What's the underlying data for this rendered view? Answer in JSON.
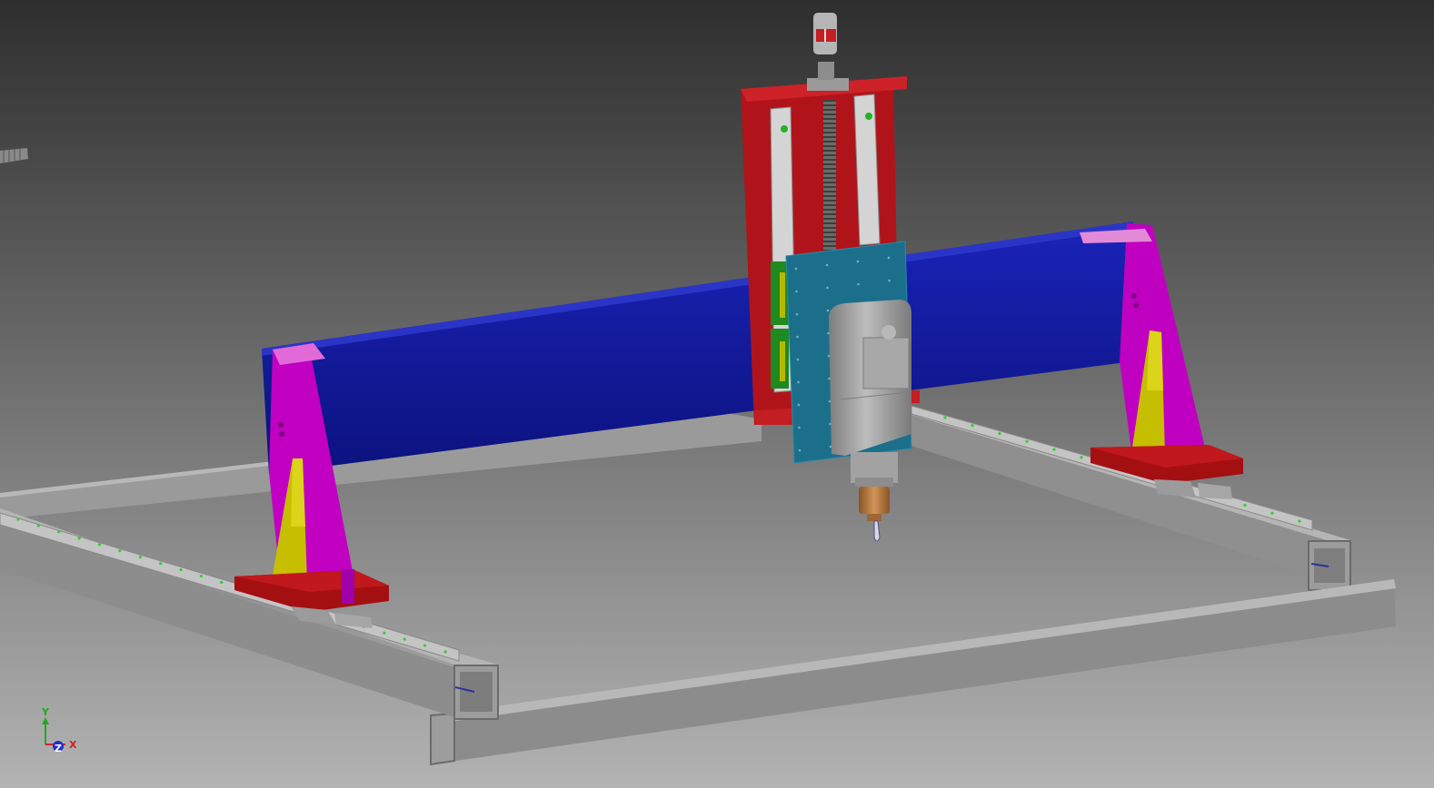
{
  "viewport": {
    "background_top": "#2e2e2e",
    "background_bottom": "#b3b3b3"
  },
  "colors": {
    "gantry_beam": "#10189a",
    "gantry_beam_edge": "#2a35c8",
    "z_plate": "#b4141a",
    "side_plate": "#c400c4",
    "side_plate_light": "#e25ee6",
    "gusset": "#c8c000",
    "foot_block": "#a80f12",
    "carriage_plate": "#1c6f8a",
    "aluminum": "#8d8d8d",
    "aluminum_dark": "#6a6a6a",
    "aluminum_light": "#b2b2b2",
    "spindle": "#9a9a9a",
    "collet": "#b7773c",
    "rail_dot": "#33cc33"
  },
  "triad": {
    "y_label": "Y",
    "x_label": "X",
    "z_label": "Z",
    "y_color": "#22aa22",
    "x_color": "#d42020",
    "z_color": "#2030d0"
  },
  "icons": {
    "triad": "view-triad-icon",
    "spindle": "spindle-icon",
    "stepper_motor": "stepper-motor-icon"
  }
}
